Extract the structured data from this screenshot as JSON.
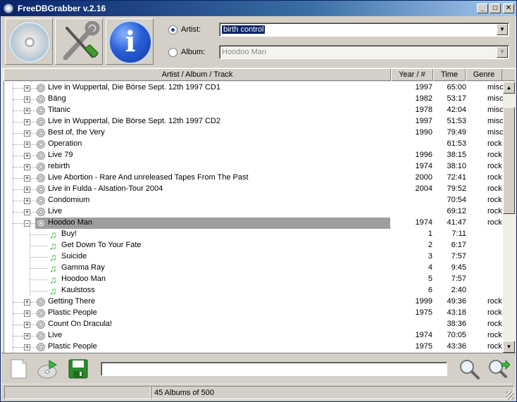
{
  "window": {
    "title": "FreeDBGrabber v.2.16",
    "controls": {
      "minimize": "_",
      "maximize": "□",
      "close": "✕"
    }
  },
  "toolbar": {
    "buttons": [
      {
        "name": "cd-button",
        "icon": "cd-disc-icon"
      },
      {
        "name": "settings-button",
        "icon": "tools-icon"
      },
      {
        "name": "info-button",
        "icon": "info-icon",
        "glyph": "i"
      }
    ]
  },
  "search_mode": {
    "artist_label": "Artist:",
    "artist_value": "birth control",
    "artist_selected": true,
    "album_label": "Album:",
    "album_value": "Hoodoo Man",
    "album_selected": false
  },
  "columns": {
    "title": "Artist / Album / Track",
    "year": "Year / #",
    "time": "Time",
    "genre": "Genre"
  },
  "rows": [
    {
      "type": "album",
      "label": "Live in Wuppertal, Die Börse Sept. 12th 1997 CD1",
      "year": "1997",
      "time": "65:00",
      "genre": "misc"
    },
    {
      "type": "album",
      "label": "Bäng",
      "year": "1982",
      "time": "53:17",
      "genre": "misc"
    },
    {
      "type": "album",
      "label": "Titanic",
      "year": "1978",
      "time": "42:04",
      "genre": "misc"
    },
    {
      "type": "album",
      "label": "Live in Wuppertal, Die Börse Sept. 12th 1997 CD2",
      "year": "1997",
      "time": "51:53",
      "genre": "misc"
    },
    {
      "type": "album",
      "label": "Best of, the Very",
      "year": "1990",
      "time": "79:49",
      "genre": "misc"
    },
    {
      "type": "album",
      "label": "Operation",
      "year": "",
      "time": "61:53",
      "genre": "rock"
    },
    {
      "type": "album",
      "label": "Live 79",
      "year": "1996",
      "time": "38:15",
      "genre": "rock"
    },
    {
      "type": "album",
      "label": "rebirth",
      "year": "1974",
      "time": "38:10",
      "genre": "rock"
    },
    {
      "type": "album",
      "label": "Live Abortion - Rare And unreleased Tapes From The Past",
      "year": "2000",
      "time": "72:41",
      "genre": "rock"
    },
    {
      "type": "album",
      "label": "Live in Fulda - Alsation-Tour 2004",
      "year": "2004",
      "time": "79:52",
      "genre": "rock"
    },
    {
      "type": "album",
      "label": "Condomium",
      "year": "",
      "time": "70:54",
      "genre": "rock"
    },
    {
      "type": "album",
      "label": "Live",
      "year": "",
      "time": "69:12",
      "genre": "rock"
    },
    {
      "type": "album",
      "label": "Hoodoo Man",
      "year": "1974",
      "time": "41:47",
      "genre": "rock",
      "expanded": true,
      "selected": true
    },
    {
      "type": "track",
      "label": "Buy!",
      "year": "1",
      "time": "7:11",
      "genre": ""
    },
    {
      "type": "track",
      "label": "Get Down To Your Fate",
      "year": "2",
      "time": "6:17",
      "genre": ""
    },
    {
      "type": "track",
      "label": "Suicide",
      "year": "3",
      "time": "7:57",
      "genre": ""
    },
    {
      "type": "track",
      "label": "Gamma Ray",
      "year": "4",
      "time": "9:45",
      "genre": ""
    },
    {
      "type": "track",
      "label": "Hoodoo Man",
      "year": "5",
      "time": "7:57",
      "genre": ""
    },
    {
      "type": "track",
      "label": "Kaulstoss",
      "year": "6",
      "time": "2:40",
      "genre": "",
      "last": true
    },
    {
      "type": "album",
      "label": "Getting There",
      "year": "1999",
      "time": "49:36",
      "genre": "rock"
    },
    {
      "type": "album",
      "label": "Plastic People",
      "year": "1975",
      "time": "43:18",
      "genre": "rock"
    },
    {
      "type": "album",
      "label": "Count On Dracula!",
      "year": "",
      "time": "38:36",
      "genre": "rock"
    },
    {
      "type": "album",
      "label": "Live",
      "year": "1974",
      "time": "70:05",
      "genre": "rock"
    },
    {
      "type": "album",
      "label": "Plastic People",
      "year": "1975",
      "time": "43:36",
      "genre": "rock"
    }
  ],
  "bottom": {
    "search_value": "",
    "icons": [
      "new-document-icon",
      "export-disc-icon",
      "save-icon",
      "search-icon",
      "search-next-icon"
    ]
  },
  "status": {
    "left": "",
    "count": "45 Albums of 500"
  }
}
